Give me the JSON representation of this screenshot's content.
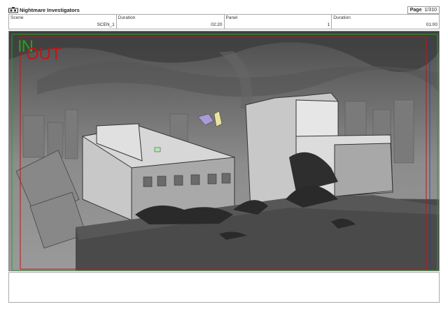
{
  "header": {
    "project_title": "Nightmare Investigators",
    "page_label": "Page",
    "page_value": "1/310"
  },
  "fields": [
    {
      "label": "Scene",
      "value": "SCEN_1"
    },
    {
      "label": "Duration",
      "value": "02:20"
    },
    {
      "label": "Panel",
      "value": "1"
    },
    {
      "label": "Duration",
      "value": "01:00"
    }
  ],
  "panel": {
    "in_label": "IN",
    "out_label": "OUT",
    "in_color": "#1fa41f",
    "out_color": "#c01616"
  },
  "notes": {
    "text": ""
  }
}
